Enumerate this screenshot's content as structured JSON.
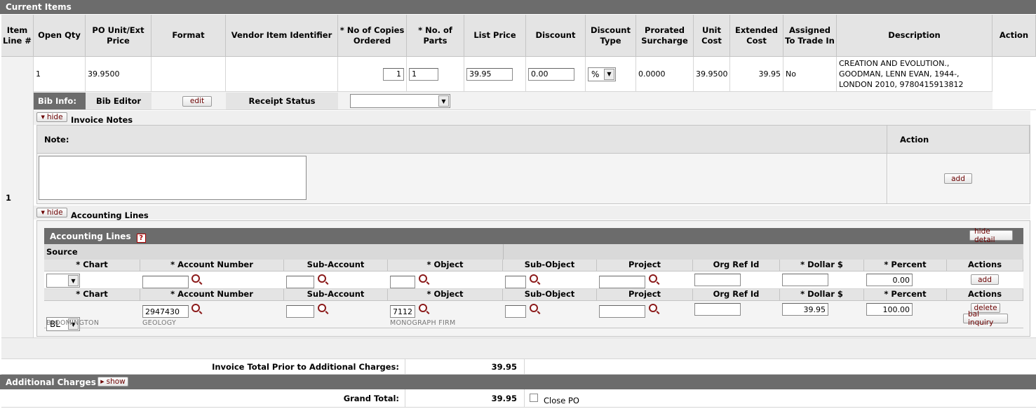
{
  "section_title": "Current Items",
  "columns": [
    "Item Line #",
    "Open Qty",
    "PO Unit/Ext Price",
    "Format",
    "Vendor Item Identifier",
    "* No of Copies Ordered",
    "* No. of Parts",
    "List Price",
    "Discount",
    "Discount Type",
    "Prorated Surcharge",
    "Unit Cost",
    "Extended Cost",
    "Assigned To Trade In",
    "Description",
    "Action"
  ],
  "item": {
    "line_number": "1",
    "open_qty": "1",
    "po_unit_price": "39.9500",
    "copies": "1",
    "parts": "1",
    "list_price": "39.95",
    "discount": "0.00",
    "discount_type": "%",
    "prorated_surcharge": "0.0000",
    "unit_cost": "39.9500",
    "extended_cost": "39.95",
    "trade_in": "No",
    "description_lines": [
      "CREATION AND EVOLUTION.,",
      "GOODMAN, LENN EVAN, 1944-,",
      "LONDON 2010, 9780415913812"
    ]
  },
  "bib": {
    "bib_info_label": "Bib Info:",
    "bib_editor_label": "Bib Editor",
    "edit_btn": "edit",
    "receipt_status_label": "Receipt Status"
  },
  "invoice_notes": {
    "hide_btn": "hide",
    "title": "Invoice Notes",
    "note_header": "Note:",
    "action_header": "Action",
    "add_btn": "add"
  },
  "accounting": {
    "hide_btn": "hide",
    "title": "Accounting Lines",
    "panel_title": "Accounting Lines",
    "help_icon": "?",
    "hide_detail_btn": "hide detail",
    "source_label": "Source",
    "headers": [
      "* Chart",
      "* Account Number",
      "Sub-Account",
      "* Object",
      "Sub-Object",
      "Project",
      "Org Ref Id",
      "* Dollar $",
      "* Percent",
      "Actions"
    ],
    "new_row": {
      "percent": "0.00",
      "add_btn": "add"
    },
    "line": {
      "chart": "BL",
      "chart_name": "BLOOMINGTON",
      "account": "2947430",
      "account_name": "GEOLOGY",
      "object": "7112",
      "object_name": "MONOGRAPH FIRM",
      "dollar": "39.95",
      "percent": "100.00",
      "delete_btn": "delete",
      "bal_inquiry_btn": "bal inquiry"
    }
  },
  "totals": {
    "prior_label": "Invoice Total Prior to Additional Charges:",
    "prior_value": "39.95",
    "additional_title": "Additional Charges",
    "show_btn": "show",
    "grand_label": "Grand Total:",
    "grand_value": "39.95",
    "close_po_label": "Close PO"
  }
}
